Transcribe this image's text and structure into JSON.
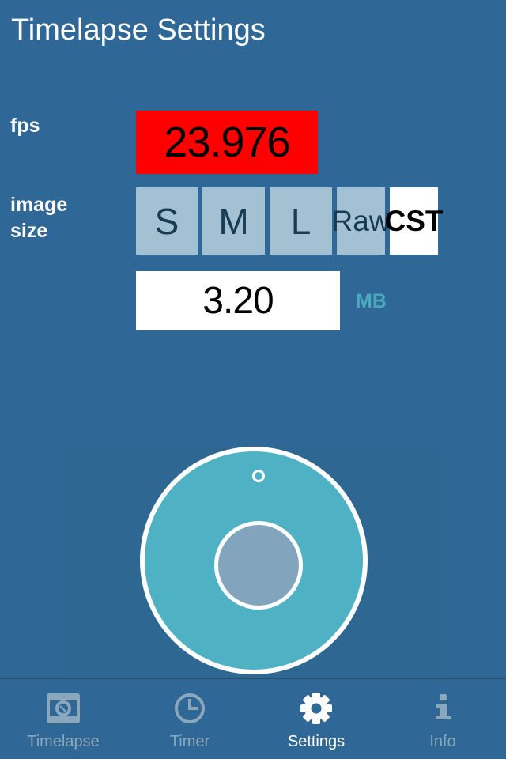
{
  "header": {
    "title": "Timelapse Settings"
  },
  "settings": {
    "fps": {
      "label": "fps",
      "value": "23.976",
      "box_color": "#ff0000",
      "text_color": "#000000"
    },
    "image_size": {
      "label": "image size",
      "label_line1": "image",
      "label_line2": "size",
      "options": [
        {
          "label": "S",
          "selected": false
        },
        {
          "label": "M",
          "selected": false
        },
        {
          "label": "L",
          "selected": false
        },
        {
          "label": "Raw",
          "selected": false
        },
        {
          "label": "CST",
          "selected": true
        }
      ]
    },
    "file_size": {
      "value": "3.20",
      "unit": "MB",
      "unit_color": "#4aa9bd",
      "box_color": "#ffffff"
    }
  },
  "knob": {
    "name": "rotary-dial",
    "ring_color": "#4fb2c4",
    "hub_color": "#82a5bd",
    "outline_color": "#ffffff",
    "marker_angle_deg": 0
  },
  "navbar": {
    "items": [
      {
        "label": "Timelapse",
        "icon": "camera-icon",
        "active": false
      },
      {
        "label": "Timer",
        "icon": "clock-icon",
        "active": false
      },
      {
        "label": "Settings",
        "icon": "gear-icon",
        "active": true
      },
      {
        "label": "Info",
        "icon": "info-icon",
        "active": false
      }
    ],
    "inactive_color": "#8ba7bc",
    "active_color": "#ffffff"
  },
  "theme": {
    "background": "#2f6896",
    "panel_background": "#2e6791",
    "button_background": "#a4c0d3",
    "button_text": "#173b52",
    "separator": "#23506f"
  }
}
